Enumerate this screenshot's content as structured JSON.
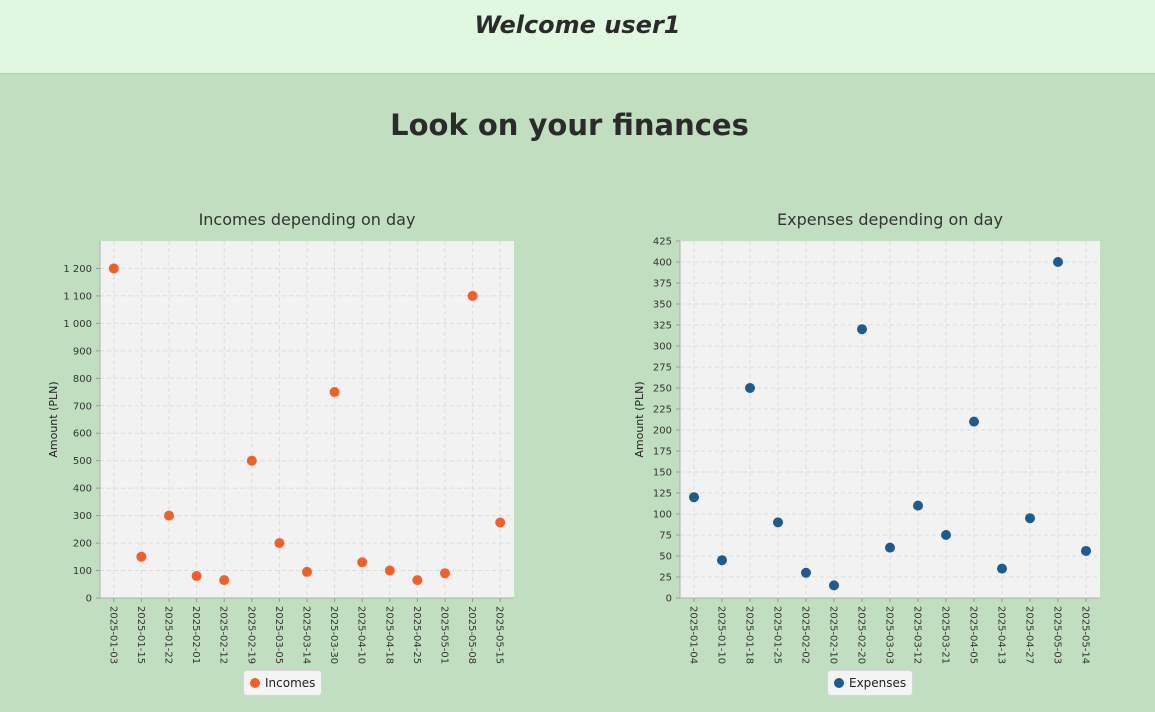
{
  "header": {
    "welcome": "Welcome user1"
  },
  "main": {
    "title": "Look on your finances"
  },
  "colors": {
    "incomes": "#f0602a",
    "expenses": "#1f5b8c",
    "plot_bg": "#f2f2f2"
  },
  "chart_data": [
    {
      "type": "scatter",
      "title": "Incomes depending on day",
      "xlabel": "",
      "ylabel": "Amount (PLN)",
      "ylim": [
        0,
        1300
      ],
      "yticks": [
        0,
        100,
        200,
        300,
        400,
        500,
        600,
        700,
        800,
        900,
        1000,
        1100,
        1200
      ],
      "ytick_labels": [
        "0",
        "100",
        "200",
        "300",
        "400",
        "500",
        "600",
        "700",
        "800",
        "900",
        "1 000",
        "1 100",
        "1 200"
      ],
      "categories": [
        "2025-01-03",
        "2025-01-15",
        "2025-01-22",
        "2025-02-01",
        "2025-02-12",
        "2025-02-19",
        "2025-03-05",
        "2025-03-14",
        "2025-03-30",
        "2025-04-10",
        "2025-04-18",
        "2025-04-25",
        "2025-05-01",
        "2025-05-08",
        "2025-05-15"
      ],
      "series": [
        {
          "name": "Incomes",
          "values": [
            1200,
            150,
            300,
            80,
            65,
            500,
            200,
            95,
            750,
            130,
            100,
            65,
            90,
            1100,
            275
          ]
        }
      ],
      "grid": true,
      "legend": "bottom"
    },
    {
      "type": "scatter",
      "title": "Expenses depending on day",
      "xlabel": "",
      "ylabel": "Amount (PLN)",
      "ylim": [
        0,
        425
      ],
      "yticks": [
        0,
        25,
        50,
        75,
        100,
        125,
        150,
        175,
        200,
        225,
        250,
        275,
        300,
        325,
        350,
        375,
        400,
        425
      ],
      "ytick_labels": [
        "0",
        "25",
        "50",
        "75",
        "100",
        "125",
        "150",
        "175",
        "200",
        "225",
        "250",
        "275",
        "300",
        "325",
        "350",
        "375",
        "400",
        "425"
      ],
      "categories": [
        "2025-01-04",
        "2025-01-10",
        "2025-01-18",
        "2025-01-25",
        "2025-02-02",
        "2025-02-10",
        "2025-02-20",
        "2025-03-03",
        "2025-03-12",
        "2025-03-21",
        "2025-04-05",
        "2025-04-13",
        "2025-04-27",
        "2025-05-03",
        "2025-05-14"
      ],
      "series": [
        {
          "name": "Expenses",
          "values": [
            120,
            45,
            250,
            90,
            30,
            15,
            320,
            60,
            110,
            75,
            210,
            35,
            95,
            400,
            56
          ]
        }
      ],
      "grid": true,
      "legend": "bottom"
    }
  ]
}
